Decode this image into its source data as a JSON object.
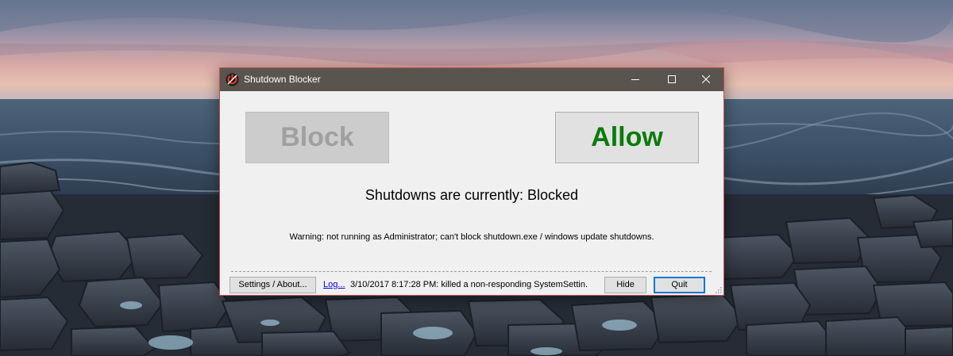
{
  "window": {
    "title": "Shutdown Blocker",
    "controls": {
      "minimize": "minimize-icon",
      "maximize": "maximize-icon",
      "close": "close-icon"
    }
  },
  "main": {
    "block_label": "Block",
    "allow_label": "Allow",
    "status_text": "Shutdowns are currently: Blocked",
    "warning_text": "Warning: not running as Administrator; can't block shutdown.exe / windows update shutdowns."
  },
  "footer": {
    "settings_label": "Settings / About...",
    "log_link": "Log...",
    "log_text": "3/10/2017 8:17:28 PM: killed a non-responding SystemSettin...",
    "hide_label": "Hide",
    "quit_label": "Quit"
  },
  "colors": {
    "titlebar": "#5a544f",
    "window_border": "#c0504d",
    "allow_text": "#0b7a0b",
    "disabled_text": "#a0a0a0",
    "link": "#0000ee"
  }
}
